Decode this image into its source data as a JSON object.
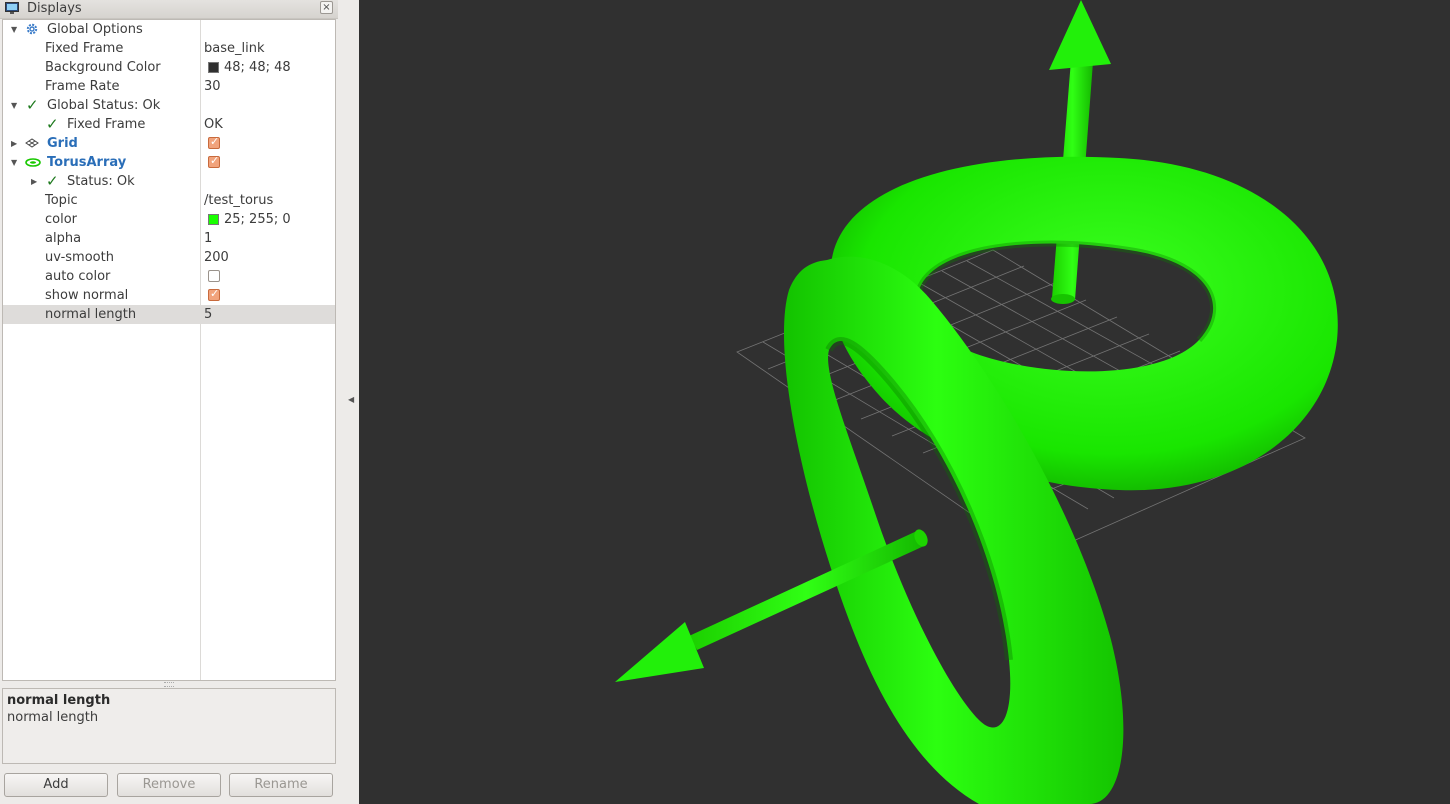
{
  "panel": {
    "title": "Displays",
    "close_label": "×"
  },
  "tree": {
    "rows": [
      {
        "name": "Global Options"
      },
      {
        "name": "Fixed Frame",
        "value": "base_link"
      },
      {
        "name": "Background Color",
        "value": "48; 48; 48",
        "swatch": "#303030"
      },
      {
        "name": "Frame Rate",
        "value": "30"
      },
      {
        "name": "Global Status: Ok"
      },
      {
        "name": "Fixed Frame",
        "value": "OK"
      },
      {
        "name": "Grid",
        "checked": true
      },
      {
        "name": "TorusArray",
        "checked": true
      },
      {
        "name": "Status: Ok"
      },
      {
        "name": "Topic",
        "value": "/test_torus"
      },
      {
        "name": "color",
        "value": "25; 255; 0",
        "swatch": "#19ff00"
      },
      {
        "name": "alpha",
        "value": "1"
      },
      {
        "name": "uv-smooth",
        "value": "200"
      },
      {
        "name": "auto color",
        "checked": false
      },
      {
        "name": "show normal",
        "checked": true
      },
      {
        "name": "normal length",
        "value": "5",
        "selected": true
      }
    ]
  },
  "description": {
    "title": "normal length",
    "body": "normal length"
  },
  "buttons": {
    "add": "Add",
    "remove": "Remove",
    "rename": "Rename"
  },
  "viewport": {
    "background": "#303030",
    "accent": "#19ff00"
  }
}
